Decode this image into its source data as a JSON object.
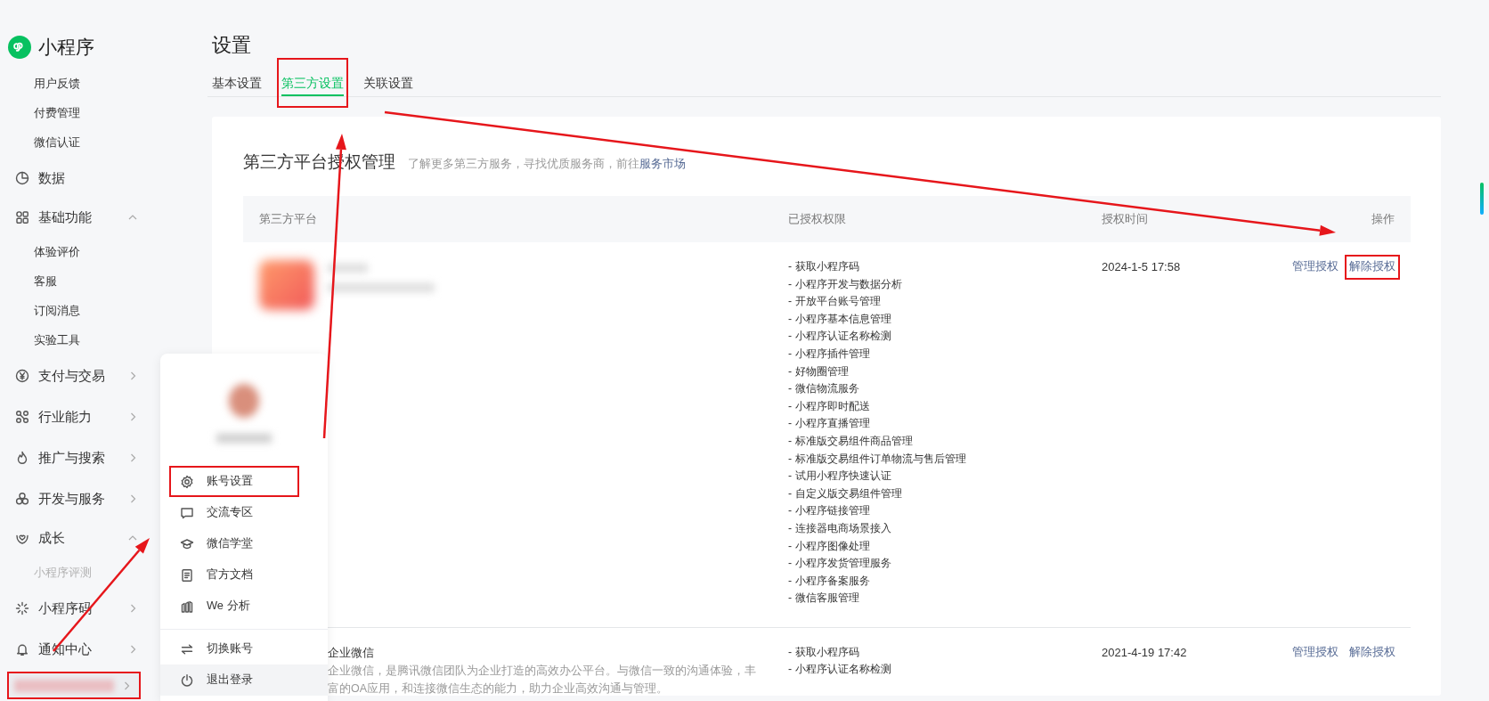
{
  "sidebar": {
    "app_name": "小程序",
    "items": [
      {
        "kind": "sub",
        "label": "用户反馈",
        "faded": false,
        "highlighted": false
      },
      {
        "kind": "sub",
        "label": "付费管理",
        "faded": false,
        "highlighted": false
      },
      {
        "kind": "sub",
        "label": "微信认证",
        "faded": false,
        "highlighted": false
      },
      {
        "kind": "link",
        "label": "数据",
        "highlighted": false
      },
      {
        "kind": "group",
        "label": "基础功能",
        "expanded": true,
        "highlighted": false
      },
      {
        "kind": "sub",
        "label": "体验评价",
        "faded": false,
        "highlighted": false
      },
      {
        "kind": "sub",
        "label": "客服",
        "faded": false,
        "highlighted": false
      },
      {
        "kind": "sub",
        "label": "订阅消息",
        "faded": false,
        "highlighted": false
      },
      {
        "kind": "sub",
        "label": "实验工具",
        "faded": false,
        "highlighted": false
      },
      {
        "kind": "group",
        "label": "支付与交易",
        "expanded": false,
        "highlighted": false
      },
      {
        "kind": "group",
        "label": "行业能力",
        "expanded": false,
        "highlighted": false
      },
      {
        "kind": "group",
        "label": "推广与搜索",
        "expanded": false,
        "highlighted": false
      },
      {
        "kind": "group",
        "label": "开发与服务",
        "expanded": false,
        "highlighted": false
      },
      {
        "kind": "group",
        "label": "成长",
        "expanded": true,
        "highlighted": false
      },
      {
        "kind": "sub",
        "label": "小程序评测",
        "faded": true,
        "highlighted": false
      },
      {
        "kind": "group",
        "label": "小程序码",
        "expanded": false,
        "highlighted": false
      },
      {
        "kind": "group",
        "label": "通知中心",
        "expanded": false,
        "highlighted": false
      },
      {
        "kind": "account",
        "expanded": false,
        "highlighted": true
      }
    ]
  },
  "page": {
    "title": "设置",
    "tabs": [
      {
        "label": "基本设置",
        "selected": false,
        "highlighted": false
      },
      {
        "label": "第三方设置",
        "selected": true,
        "highlighted": true
      },
      {
        "label": "关联设置",
        "selected": false,
        "highlighted": false
      }
    ],
    "card": {
      "title": "第三方平台授权管理",
      "hint": "了解更多第三方服务，寻找优质服务商，前往",
      "hint_link": "服务市场",
      "table": {
        "columns": [
          "第三方平台",
          "已授权权限",
          "授权时间",
          "操作"
        ],
        "rows": [
          {
            "kind": "blurred",
            "permissions": [
              "- 获取小程序码",
              "- 小程序开发与数据分析",
              "- 开放平台账号管理",
              "- 小程序基本信息管理",
              "- 小程序认证名称检测",
              "- 小程序插件管理",
              "- 好物圈管理",
              "- 微信物流服务",
              "- 小程序即时配送",
              "- 小程序直播管理",
              "- 标准版交易组件商品管理",
              "- 标准版交易组件订单物流与售后管理",
              "- 试用小程序快速认证",
              "- 自定义版交易组件管理",
              "- 小程序链接管理",
              "- 连接器电商场景接入",
              "- 小程序图像处理",
              "- 小程序发货管理服务",
              "- 小程序备案服务",
              "- 微信客服管理"
            ],
            "time": "2024-1-5 17:58",
            "actions": [
              {
                "label": "管理授权",
                "highlighted": false
              },
              {
                "label": "解除授权",
                "highlighted": true
              }
            ]
          },
          {
            "kind": "plain",
            "name": "企业微信",
            "description": "企业微信，是腾讯微信团队为企业打造的高效办公平台。与微信一致的沟通体验，丰富的OA应用，和连接微信生态的能力，助力企业高效沟通与管理。",
            "permissions": [
              "- 获取小程序码",
              "- 小程序认证名称检测"
            ],
            "time": "2021-4-19 17:42",
            "actions": [
              {
                "label": "管理授权",
                "highlighted": false
              },
              {
                "label": "解除授权",
                "highlighted": false
              }
            ]
          }
        ]
      }
    }
  },
  "account_menu": {
    "items": [
      {
        "kind": "gear",
        "label": "账号设置",
        "highlighted": true,
        "selected": false
      },
      {
        "kind": "chat",
        "label": "交流专区",
        "highlighted": false,
        "selected": false
      },
      {
        "kind": "cap",
        "label": "微信学堂",
        "highlighted": false,
        "selected": false
      },
      {
        "kind": "doc",
        "label": "官方文档",
        "highlighted": false,
        "selected": false
      },
      {
        "kind": "chart",
        "label": "We 分析",
        "highlighted": false,
        "selected": false
      },
      {
        "kind": "divider"
      },
      {
        "kind": "switch",
        "label": "切换账号",
        "highlighted": false,
        "selected": false
      },
      {
        "kind": "power",
        "label": "退出登录",
        "highlighted": false,
        "selected": true
      }
    ]
  }
}
